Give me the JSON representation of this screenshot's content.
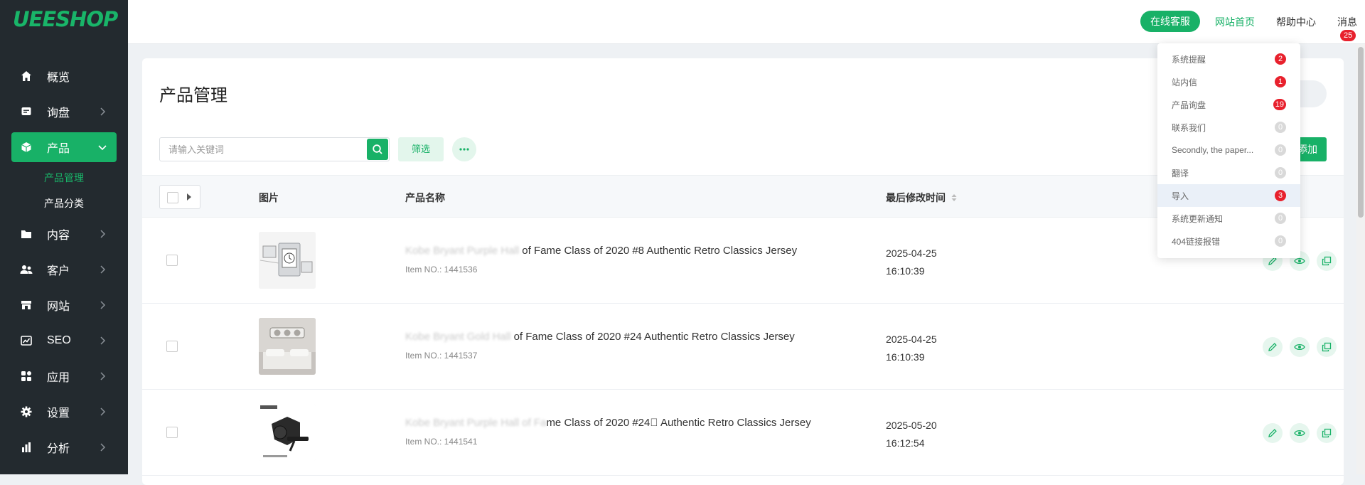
{
  "brand": {
    "logo": "UEESHOP",
    "accent": "#18b167",
    "sidebar_bg": "#232a2f",
    "badge_red": "#e8212d"
  },
  "sidebar": {
    "items": [
      {
        "label": "概览",
        "icon": "home-icon"
      },
      {
        "label": "询盘",
        "icon": "inquiry-icon"
      },
      {
        "label": "产品",
        "icon": "product-box-icon",
        "active": true
      },
      {
        "label": "内容",
        "icon": "content-folder-icon"
      },
      {
        "label": "客户",
        "icon": "customers-icon"
      },
      {
        "label": "网站",
        "icon": "store-icon"
      },
      {
        "label": "SEO",
        "icon": "seo-chart-icon"
      },
      {
        "label": "应用",
        "icon": "apps-grid-icon"
      },
      {
        "label": "设置",
        "icon": "gear-icon"
      },
      {
        "label": "分析",
        "icon": "bar-chart-icon"
      }
    ],
    "subitems": [
      {
        "label": "产品管理",
        "current": true
      },
      {
        "label": "产品分类"
      }
    ]
  },
  "topbar": {
    "online_service": "在线客服",
    "home_link": "网站首页",
    "help_link": "帮助中心",
    "messages_label": "消息",
    "messages_count": "25"
  },
  "page": {
    "title": "产品管理",
    "search_placeholder": "请输入关键词",
    "filter_label": "筛选",
    "add_label": "添加"
  },
  "table": {
    "headers": {
      "image": "图片",
      "name": "产品名称",
      "modified": "最后修改时间"
    },
    "rows": [
      {
        "name_blurred": "Kobe Bryant Purple Hall",
        "name": "of Fame Class of 2020 #8 Authentic Retro Classics Jersey",
        "item_no": "Item NO.: 1441536",
        "date": "2025-04-25",
        "time": "16:10:39"
      },
      {
        "name_blurred": "Kobe Bryant Gold Hall",
        "name": "of Fame Class of 2020 #24 Authentic Retro Classics Jersey",
        "item_no": "Item NO.: 1441537",
        "date": "2025-04-25",
        "time": "16:10:39"
      },
      {
        "name_blurred": "Kobe Bryant Purple Hall of Fa",
        "name": "me Class of 2020 #24\u0000 Authentic Retro Classics Jersey",
        "item_no": "Item NO.: 1441541",
        "date": "2025-05-20",
        "time": "16:12:54"
      }
    ]
  },
  "dropdown": {
    "items": [
      {
        "label": "系统提醒",
        "count": "2",
        "tone": "red"
      },
      {
        "label": "站内信",
        "count": "1",
        "tone": "red"
      },
      {
        "label": "产品询盘",
        "count": "19",
        "tone": "red"
      },
      {
        "label": "联系我们",
        "count": "0",
        "tone": "grey"
      },
      {
        "label": "Secondly, the paper...",
        "count": "0",
        "tone": "grey"
      },
      {
        "label": "翻译",
        "count": "0",
        "tone": "grey"
      },
      {
        "label": "导入",
        "count": "3",
        "tone": "red",
        "highlighted": true
      },
      {
        "label": "系统更新通知",
        "count": "0",
        "tone": "grey"
      },
      {
        "label": "404链接报错",
        "count": "0",
        "tone": "grey"
      }
    ]
  }
}
